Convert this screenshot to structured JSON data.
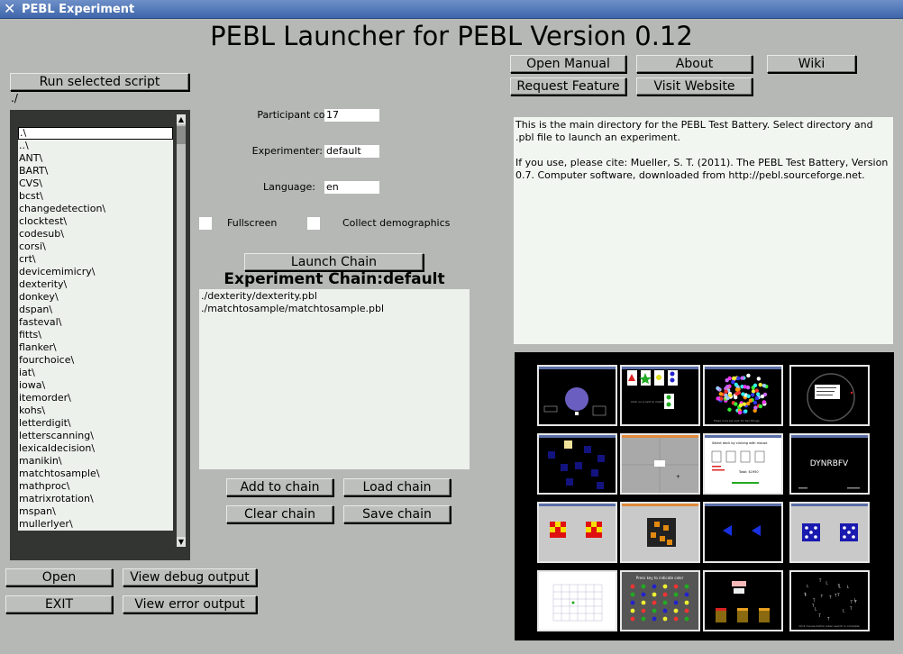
{
  "window": {
    "title": "PEBL Experiment"
  },
  "header": {
    "title": "PEBL Launcher for PEBL Version 0.12"
  },
  "buttons": {
    "run_selected": "Run selected script",
    "open_manual": "Open Manual",
    "about": "About",
    "wiki": "Wiki",
    "request_feature": "Request Feature",
    "visit_website": "Visit Website",
    "launch_chain": "Launch Chain",
    "add_to_chain": "Add to chain",
    "load_chain": "Load chain",
    "clear_chain": "Clear chain",
    "save_chain": "Save chain",
    "open": "Open",
    "view_debug": "View debug output",
    "exit": "EXIT",
    "view_error": "View error output"
  },
  "current_dir": "./",
  "files": [
    ".\\",
    "..\\",
    "ANT\\",
    "BART\\",
    "CVS\\",
    "bcst\\",
    "changedetection\\",
    "clocktest\\",
    "codesub\\",
    "corsi\\",
    "crt\\",
    "devicemimicry\\",
    "dexterity\\",
    "donkey\\",
    "dspan\\",
    "fasteval\\",
    "fitts\\",
    "flanker\\",
    "fourchoice\\",
    "iat\\",
    "iowa\\",
    "itemorder\\",
    "kohs\\",
    "letterdigit\\",
    "letterscanning\\",
    "lexicaldecision\\",
    "manikin\\",
    "matchtosample\\",
    "mathproc\\",
    "matrixrotation\\",
    "mspan\\",
    "mullerlyer\\"
  ],
  "form": {
    "participant_label": "Participant code:",
    "participant_value": "17",
    "experimenter_label": "Experimenter:",
    "experimenter_value": "default",
    "language_label": "Language:",
    "language_value": "en",
    "fullscreen_label": "Fullscreen",
    "demographics_label": "Collect demographics"
  },
  "chain": {
    "title": "Experiment Chain:default",
    "items": [
      "./dexterity/dexterity.pbl",
      "./matchtosample/matchtosample.pbl"
    ]
  },
  "description": {
    "p1": "This is the main directory for the PEBL Test Battery. Select directory and .pbl file to launch an experiment.",
    "p2": "If you use, please cite: Mueller, S. T. (2011). The PEBL Test Battery, Version 0.7. Computer software, downloaded from http://pebl.sourceforge.net."
  },
  "thumbnail_text": {
    "t3": "Click on a card to match...",
    "t4": "Press once per pair for two things",
    "t7": "Select deck by clicking with mouse",
    "t7b": "Total: $1950",
    "t8": "DYNRBFV",
    "t14": "Press key to indicate color",
    "t16": "Click mouse button when search is complete"
  },
  "colors": {
    "accent": "#3f66ab",
    "background": "#b5b8b5",
    "panel": "#333533"
  }
}
